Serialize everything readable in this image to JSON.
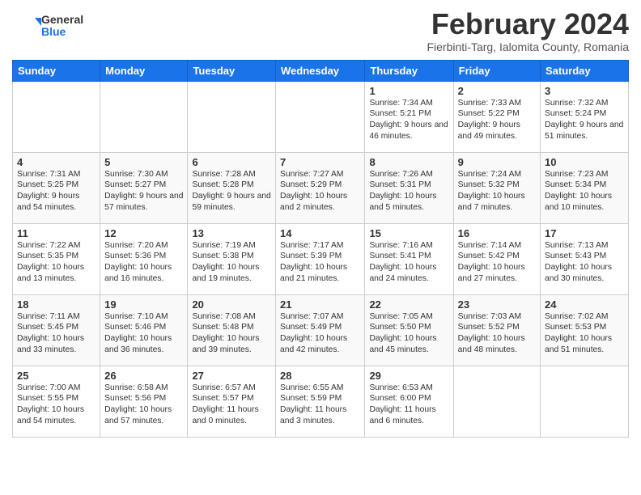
{
  "logo": {
    "general": "General",
    "blue": "Blue"
  },
  "title": {
    "month_year": "February 2024",
    "location": "Fierbinti-Targ, Ialomita County, Romania"
  },
  "headers": [
    "Sunday",
    "Monday",
    "Tuesday",
    "Wednesday",
    "Thursday",
    "Friday",
    "Saturday"
  ],
  "weeks": [
    [
      {
        "day": "",
        "content": ""
      },
      {
        "day": "",
        "content": ""
      },
      {
        "day": "",
        "content": ""
      },
      {
        "day": "",
        "content": ""
      },
      {
        "day": "1",
        "content": "Sunrise: 7:34 AM\nSunset: 5:21 PM\nDaylight: 9 hours and 46 minutes."
      },
      {
        "day": "2",
        "content": "Sunrise: 7:33 AM\nSunset: 5:22 PM\nDaylight: 9 hours and 49 minutes."
      },
      {
        "day": "3",
        "content": "Sunrise: 7:32 AM\nSunset: 5:24 PM\nDaylight: 9 hours and 51 minutes."
      }
    ],
    [
      {
        "day": "4",
        "content": "Sunrise: 7:31 AM\nSunset: 5:25 PM\nDaylight: 9 hours and 54 minutes."
      },
      {
        "day": "5",
        "content": "Sunrise: 7:30 AM\nSunset: 5:27 PM\nDaylight: 9 hours and 57 minutes."
      },
      {
        "day": "6",
        "content": "Sunrise: 7:28 AM\nSunset: 5:28 PM\nDaylight: 9 hours and 59 minutes."
      },
      {
        "day": "7",
        "content": "Sunrise: 7:27 AM\nSunset: 5:29 PM\nDaylight: 10 hours and 2 minutes."
      },
      {
        "day": "8",
        "content": "Sunrise: 7:26 AM\nSunset: 5:31 PM\nDaylight: 10 hours and 5 minutes."
      },
      {
        "day": "9",
        "content": "Sunrise: 7:24 AM\nSunset: 5:32 PM\nDaylight: 10 hours and 7 minutes."
      },
      {
        "day": "10",
        "content": "Sunrise: 7:23 AM\nSunset: 5:34 PM\nDaylight: 10 hours and 10 minutes."
      }
    ],
    [
      {
        "day": "11",
        "content": "Sunrise: 7:22 AM\nSunset: 5:35 PM\nDaylight: 10 hours and 13 minutes."
      },
      {
        "day": "12",
        "content": "Sunrise: 7:20 AM\nSunset: 5:36 PM\nDaylight: 10 hours and 16 minutes."
      },
      {
        "day": "13",
        "content": "Sunrise: 7:19 AM\nSunset: 5:38 PM\nDaylight: 10 hours and 19 minutes."
      },
      {
        "day": "14",
        "content": "Sunrise: 7:17 AM\nSunset: 5:39 PM\nDaylight: 10 hours and 21 minutes."
      },
      {
        "day": "15",
        "content": "Sunrise: 7:16 AM\nSunset: 5:41 PM\nDaylight: 10 hours and 24 minutes."
      },
      {
        "day": "16",
        "content": "Sunrise: 7:14 AM\nSunset: 5:42 PM\nDaylight: 10 hours and 27 minutes."
      },
      {
        "day": "17",
        "content": "Sunrise: 7:13 AM\nSunset: 5:43 PM\nDaylight: 10 hours and 30 minutes."
      }
    ],
    [
      {
        "day": "18",
        "content": "Sunrise: 7:11 AM\nSunset: 5:45 PM\nDaylight: 10 hours and 33 minutes."
      },
      {
        "day": "19",
        "content": "Sunrise: 7:10 AM\nSunset: 5:46 PM\nDaylight: 10 hours and 36 minutes."
      },
      {
        "day": "20",
        "content": "Sunrise: 7:08 AM\nSunset: 5:48 PM\nDaylight: 10 hours and 39 minutes."
      },
      {
        "day": "21",
        "content": "Sunrise: 7:07 AM\nSunset: 5:49 PM\nDaylight: 10 hours and 42 minutes."
      },
      {
        "day": "22",
        "content": "Sunrise: 7:05 AM\nSunset: 5:50 PM\nDaylight: 10 hours and 45 minutes."
      },
      {
        "day": "23",
        "content": "Sunrise: 7:03 AM\nSunset: 5:52 PM\nDaylight: 10 hours and 48 minutes."
      },
      {
        "day": "24",
        "content": "Sunrise: 7:02 AM\nSunset: 5:53 PM\nDaylight: 10 hours and 51 minutes."
      }
    ],
    [
      {
        "day": "25",
        "content": "Sunrise: 7:00 AM\nSunset: 5:55 PM\nDaylight: 10 hours and 54 minutes."
      },
      {
        "day": "26",
        "content": "Sunrise: 6:58 AM\nSunset: 5:56 PM\nDaylight: 10 hours and 57 minutes."
      },
      {
        "day": "27",
        "content": "Sunrise: 6:57 AM\nSunset: 5:57 PM\nDaylight: 11 hours and 0 minutes."
      },
      {
        "day": "28",
        "content": "Sunrise: 6:55 AM\nSunset: 5:59 PM\nDaylight: 11 hours and 3 minutes."
      },
      {
        "day": "29",
        "content": "Sunrise: 6:53 AM\nSunset: 6:00 PM\nDaylight: 11 hours and 6 minutes."
      },
      {
        "day": "",
        "content": ""
      },
      {
        "day": "",
        "content": ""
      }
    ]
  ]
}
